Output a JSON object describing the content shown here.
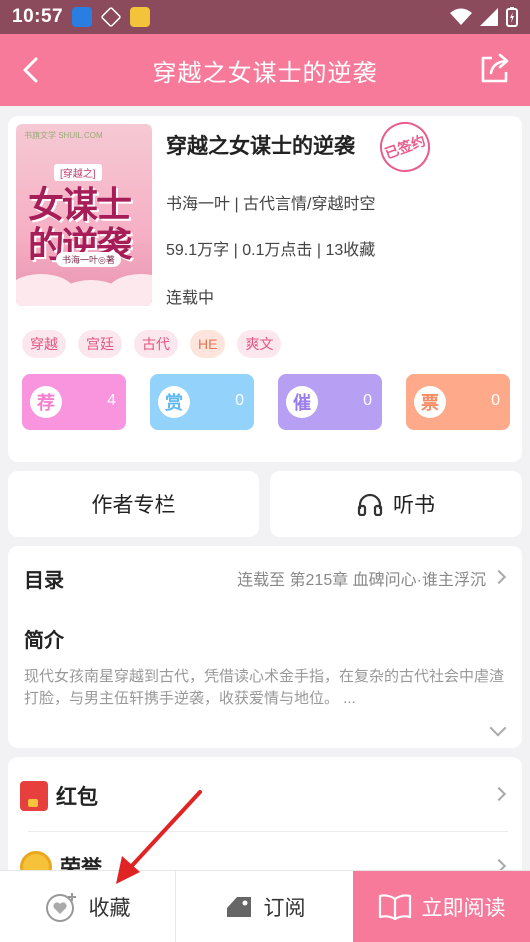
{
  "statusbar": {
    "time": "10:57"
  },
  "header": {
    "title": "穿越之女谋士的逆袭"
  },
  "book": {
    "title": "穿越之女谋士的逆袭",
    "signed_badge": "已签约",
    "author_genre": "书海一叶 | 古代言情/穿越时空",
    "stats": "59.1万字 | 0.1万点击 | 13收藏",
    "status": "连载中",
    "cover": {
      "tag": "[穿越之]",
      "line1": "女谋士",
      "line2": "的逆袭",
      "author": "书海一叶◎著",
      "publisher": "书旗文学 SHUIL.COM"
    }
  },
  "tags": [
    "穿越",
    "宫廷",
    "古代",
    "HE",
    "爽文"
  ],
  "actions": [
    {
      "icon": "荐",
      "count": "4"
    },
    {
      "icon": "赏",
      "count": "0"
    },
    {
      "icon": "催",
      "count": "0"
    },
    {
      "icon": "票",
      "count": "0"
    }
  ],
  "buttons": {
    "author_column": "作者专栏",
    "listen": "听书"
  },
  "catalog": {
    "label": "目录",
    "status": "连载至 第215章 血碑问心·谁主浮沉"
  },
  "intro": {
    "label": "简介",
    "text": "现代女孩南星穿越到古代，凭借读心术金手指，在复杂的古代社会中虐渣打脸，与男主伍轩携手逆袭，收获爱情与地位。 ..."
  },
  "gifts": {
    "red_packet": "红包",
    "honor": "荣誉"
  },
  "bottombar": {
    "favorite": "收藏",
    "subscribe": "订阅",
    "read_now": "立即阅读"
  },
  "colors": {
    "brand_pink": "#f77a9b",
    "annotation_red": "#e02424"
  }
}
